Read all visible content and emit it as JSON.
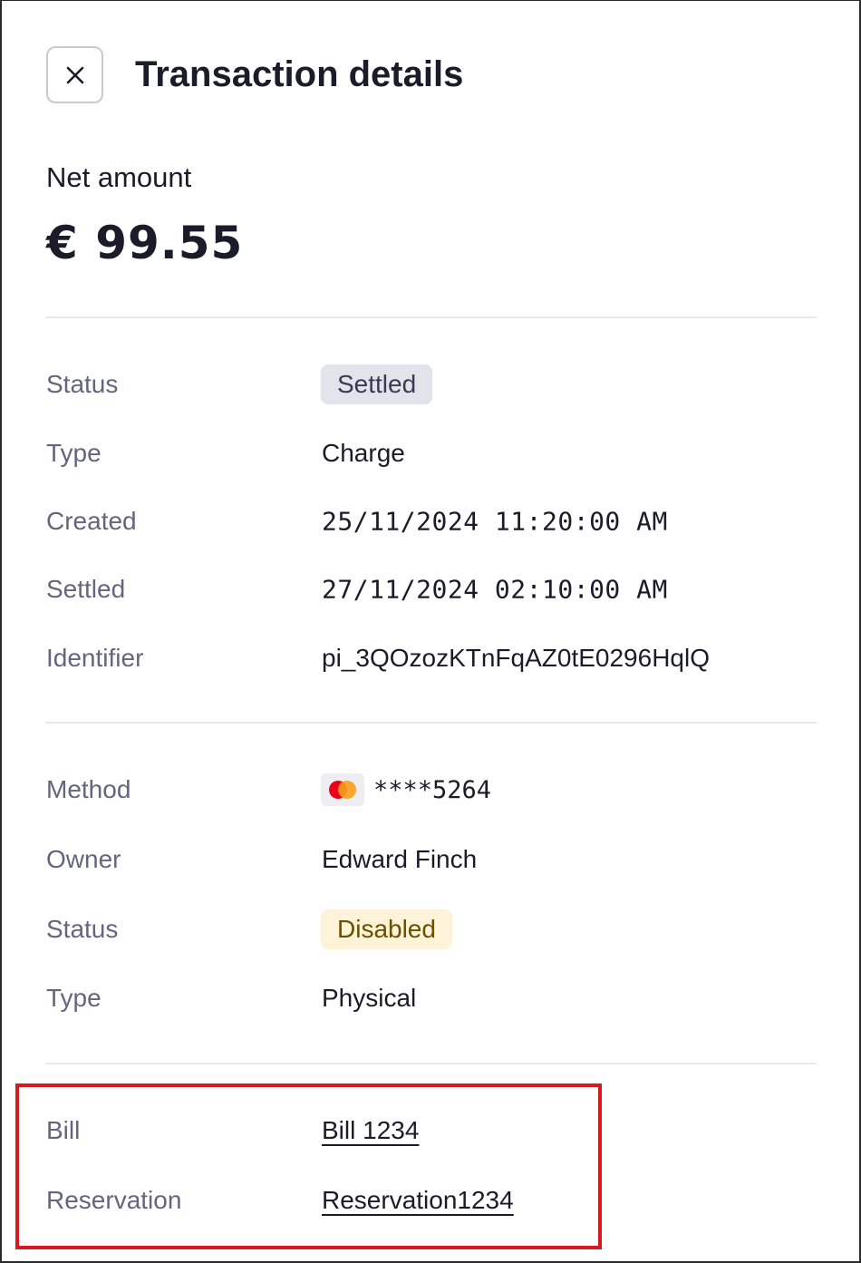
{
  "header": {
    "title": "Transaction details",
    "close_icon": "close-icon"
  },
  "summary": {
    "net_label": "Net amount",
    "net_value": "€ 99.55"
  },
  "transaction": {
    "status_label": "Status",
    "status_value": "Settled",
    "type_label": "Type",
    "type_value": "Charge",
    "created_label": "Created",
    "created_value": "25/11/2024 11:20:00 AM",
    "settled_label": "Settled",
    "settled_value": "27/11/2024 02:10:00 AM",
    "identifier_label": "Identifier",
    "identifier_value": "pi_3QOzozKTnFqAZ0tE0296HqlQ"
  },
  "payment_method": {
    "method_label": "Method",
    "card_brand_icon": "mastercard-icon",
    "card_masked": "****5264",
    "owner_label": "Owner",
    "owner_value": "Edward Finch",
    "status_label": "Status",
    "status_value": "Disabled",
    "type_label": "Type",
    "type_value": "Physical"
  },
  "references": {
    "bill_label": "Bill",
    "bill_value": "Bill 1234",
    "reservation_label": "Reservation",
    "reservation_value": "Reservation1234"
  },
  "colors": {
    "highlight": "#d71920",
    "settled_badge_bg": "#e3e3ec",
    "disabled_badge_bg": "#fdf3d9",
    "mastercard_red": "#eb001b",
    "mastercard_orange": "#f79e1b"
  }
}
